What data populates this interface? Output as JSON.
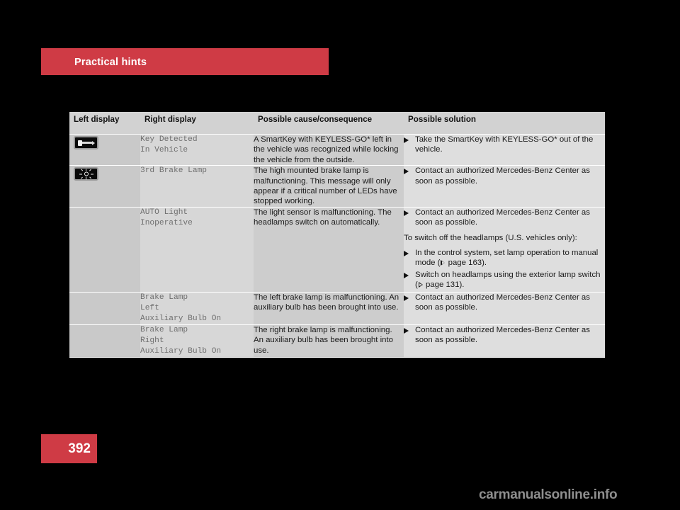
{
  "banner": {
    "title": "Practical hints"
  },
  "footer": {
    "page_number": "392",
    "watermark": "carmanualsonline.info"
  },
  "colors": {
    "accent_red": "#cf3b45",
    "banner_text": "#ffffff",
    "header_bg": "#d2d2d2",
    "col_left_bg": "#c9c9c9",
    "col_right_bg": "#d7d7d7",
    "col_cause_bg": "#cdcdcd",
    "col_solution_bg": "#dedede",
    "mono_text": "#6f6f6f",
    "body_text": "#1a1a1a",
    "page_bg": "#000000",
    "watermark_text": "#8e8e8e"
  },
  "table": {
    "headers": [
      "Left display",
      "Right display",
      "Possible cause/consequence",
      "Possible solution"
    ],
    "rows": [
      {
        "icon": "key-in-vehicle-icon",
        "right_display": "Key Detected\nIn Vehicle",
        "cause": "A SmartKey with KEYLESS-GO* left in the vehicle was recognized while locking the vehicle from the outside.",
        "solution_blocks": [
          {
            "type": "bullet",
            "text": "Take the SmartKey with KEYLESS-GO* out of the vehicle."
          }
        ]
      },
      {
        "icon": "lamp-malfunction-icon",
        "right_display": "3rd Brake Lamp",
        "cause": "The high mounted brake lamp is malfunctioning. This message will only appear if a critical number of LEDs have stopped working.",
        "solution_blocks": [
          {
            "type": "bullet",
            "text": "Contact an authorized Mercedes-Benz Center as soon as possible."
          }
        ]
      },
      {
        "icon": null,
        "right_display": "AUTO Light\nInoperative",
        "cause": "The light sensor is malfunctioning. The headlamps switch on automatically.",
        "solution_blocks": [
          {
            "type": "bullet",
            "text": "Contact an authorized Mercedes-Benz Center as soon as possible."
          },
          {
            "type": "paragraph",
            "text": "To switch off the headlamps (U.S. vehicles only):"
          },
          {
            "type": "bullet-ref",
            "text_before": "In the control system, set lamp operation to manual mode (",
            "ref": " page 163",
            "text_after": ")."
          },
          {
            "type": "bullet-ref",
            "text_before": "Switch on headlamps using the exterior lamp switch (",
            "ref": " page 131",
            "text_after": ")."
          }
        ]
      },
      {
        "icon": null,
        "right_display": "Brake Lamp\nLeft\nAuxiliary Bulb On",
        "cause": "The left brake lamp is malfunctioning. An auxiliary bulb has been brought into use.",
        "solution_blocks": [
          {
            "type": "bullet",
            "text": "Contact an authorized Mercedes-Benz Center as soon as possible."
          }
        ]
      },
      {
        "icon": null,
        "right_display": "Brake Lamp\nRight\nAuxiliary Bulb On",
        "cause": "The right brake lamp is malfunctioning. An auxiliary bulb has been brought into use.",
        "solution_blocks": [
          {
            "type": "bullet",
            "text": "Contact an authorized Mercedes-Benz Center as soon as possible."
          }
        ]
      }
    ]
  }
}
